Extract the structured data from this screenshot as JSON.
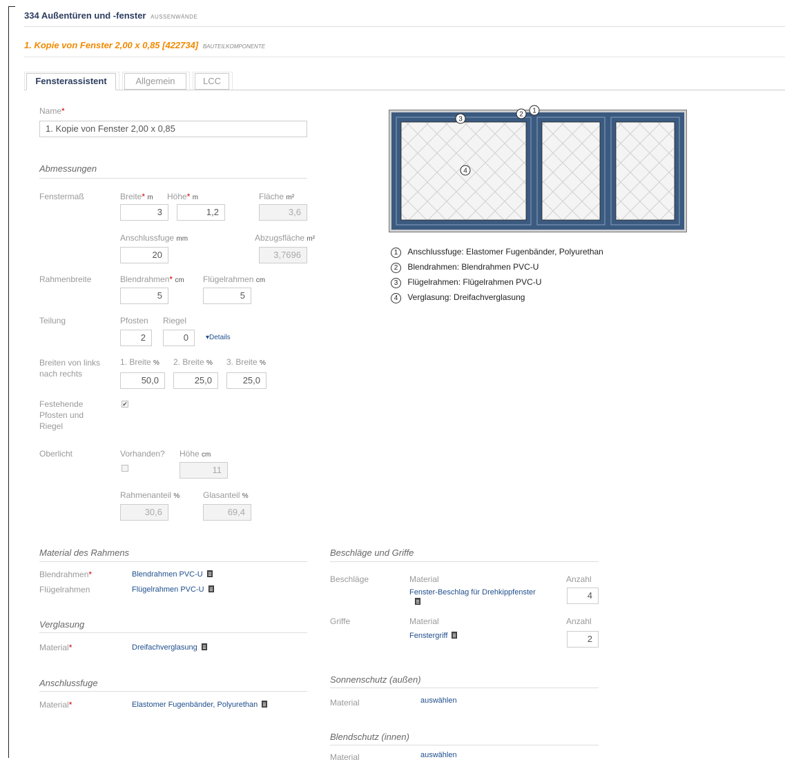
{
  "header": {
    "title": "334 Außentüren und -fenster",
    "subtitle": "AUSSENWÄNDE"
  },
  "component": {
    "title": "1. Kopie von Fenster 2,00 x 0,85 [422734]",
    "subtitle": "BAUTEILKOMPONENTE"
  },
  "tabs": [
    {
      "label": "Fensterassistent",
      "active": true
    },
    {
      "label": "Allgemein",
      "active": false
    },
    {
      "label": "LCC",
      "active": false
    }
  ],
  "name": {
    "label": "Name",
    "required": "*",
    "value": "1. Kopie von Fenster 2,00 x 0,85"
  },
  "abmessungen": {
    "title": "Abmessungen",
    "fenstermass": {
      "label": "Fenstermaß",
      "breite_label": "Breite",
      "breite_unit": "m",
      "breite": "3",
      "hoehe_label": "Höhe",
      "hoehe_unit": "m",
      "hoehe": "1,2",
      "flaeche_label": "Fläche",
      "flaeche_unit": "m²",
      "flaeche": "3,6",
      "anschlussfuge_label": "Anschlussfuge",
      "anschlussfuge_unit": "mm",
      "anschlussfuge": "20",
      "abzugsflaeche_label": "Abzugsfläche",
      "abzugsflaeche_unit": "m²",
      "abzugsflaeche": "3,7696"
    },
    "rahmenbreite": {
      "label": "Rahmenbreite",
      "blend_label": "Blendrahmen",
      "blend_unit": "cm",
      "blend": "5",
      "fluegel_label": "Flügelrahmen",
      "fluegel_unit": "cm",
      "fluegel": "5"
    },
    "teilung": {
      "label": "Teilung",
      "pfosten_label": "Pfosten",
      "pfosten": "2",
      "riegel_label": "Riegel",
      "riegel": "0",
      "details_label": "▾Details"
    },
    "breiten": {
      "label_line1": "Breiten von links",
      "label_line2": "nach rechts",
      "b1_label": "1. Breite",
      "b2_label": "2. Breite",
      "b3_label": "3. Breite",
      "unit": "%",
      "b1": "50,0",
      "b2": "25,0",
      "b3": "25,0"
    },
    "festehende": {
      "label_line1": "Festehende",
      "label_line2": "Pfosten und",
      "label_line3": "Riegel",
      "checked": true,
      "check_glyph": "✔"
    },
    "oberlicht": {
      "label": "Oberlicht",
      "vorhanden_label": "Vorhanden?",
      "hoehe_label": "Höhe",
      "hoehe_unit": "cm",
      "hoehe": "11",
      "rahmenanteil_label": "Rahmenanteil",
      "rahmenanteil_unit": "%",
      "rahmenanteil": "30,6",
      "glasanteil_label": "Glasanteil",
      "glasanteil_unit": "%",
      "glasanteil": "69,4"
    }
  },
  "diagram": {
    "frame_color": "#3b5a80",
    "glass_color": "#f4f4f4",
    "markers": [
      "1",
      "2",
      "3",
      "4"
    ]
  },
  "legend": [
    {
      "num": "1",
      "text": "Anschlussfuge: Elastomer Fugenbänder, Polyurethan"
    },
    {
      "num": "2",
      "text": "Blendrahmen: Blendrahmen PVC-U"
    },
    {
      "num": "3",
      "text": "Flügelrahmen: Flügelrahmen PVC-U"
    },
    {
      "num": "4",
      "text": "Verglasung: Dreifachverglasung"
    }
  ],
  "material_rahmen": {
    "title": "Material des Rahmens",
    "blend_label": "Blendrahmen",
    "blend_req": "*",
    "blend_value": "Blendrahmen PVC-U",
    "fluegel_label": "Flügelrahmen",
    "fluegel_value": "Flügelrahmen PVC-U"
  },
  "verglasung": {
    "title": "Verglasung",
    "label": "Material",
    "req": "*",
    "value": "Dreifachverglasung"
  },
  "anschlussfuge": {
    "title": "Anschlussfuge",
    "label": "Material",
    "req": "*",
    "value": "Elastomer Fugenbänder, Polyurethan"
  },
  "beschlaege_griffe": {
    "title": "Beschläge und Griffe",
    "beschlaege_label": "Beschläge",
    "material_label": "Material",
    "anzahl_label": "Anzahl",
    "beschlaege_value": "Fenster-Beschlag für Drehkippfenster",
    "beschlaege_anzahl": "4",
    "griffe_label": "Griffe",
    "griffe_value": "Fenstergriff",
    "griffe_anzahl": "2"
  },
  "sonnenschutz": {
    "title": "Sonnenschutz (außen)",
    "label": "Material",
    "value": "auswählen"
  },
  "blendschutz": {
    "title": "Blendschutz (innen)",
    "label": "Material",
    "value": "auswählen"
  },
  "colors": {
    "accent_orange": "#f08a00",
    "link_blue": "#1f4e8c",
    "required_red": "#cc0000"
  }
}
